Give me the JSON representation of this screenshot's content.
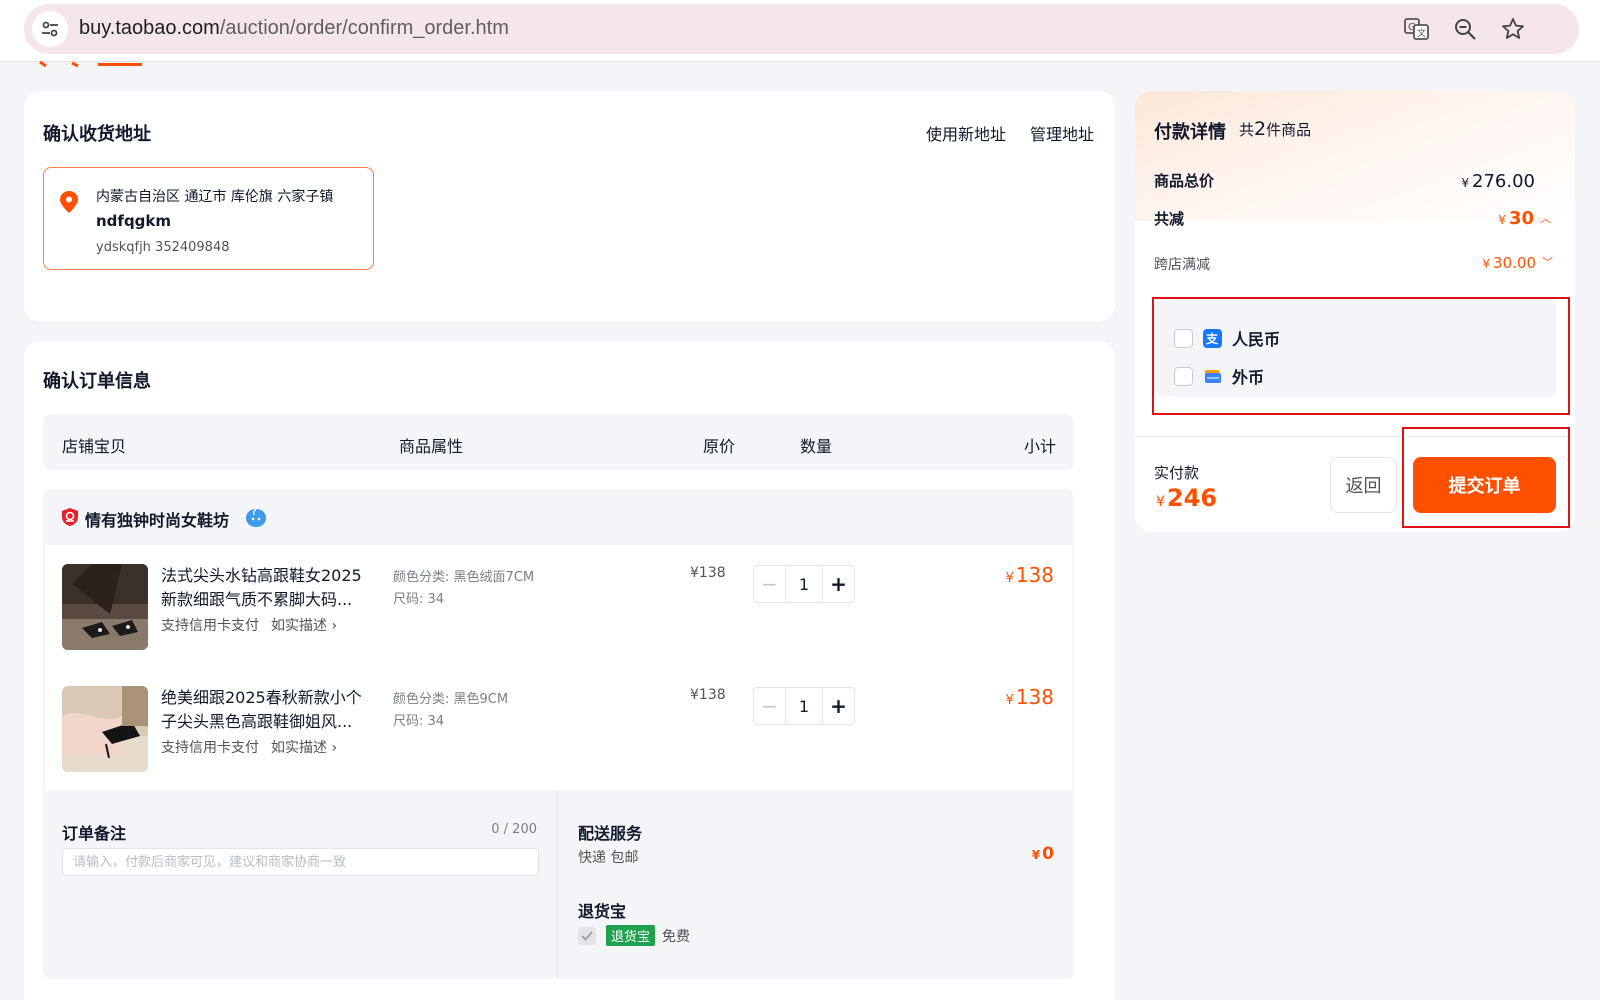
{
  "browser": {
    "url_host": "buy.taobao.com",
    "url_path": "/auction/order/confirm_order.htm",
    "icons": [
      "tune-icon",
      "translate-icon",
      "zoom-icon",
      "star-icon"
    ]
  },
  "address_section": {
    "title": "确认收货地址",
    "new_address_link": "使用新地址",
    "manage_address_link": "管理地址",
    "selected": {
      "region": "内蒙古自治区 通辽市 库伦旗 六家子镇",
      "name": "ndfqgkm",
      "detail": "ydskqfjh 352409848"
    }
  },
  "order_section": {
    "title": "确认订单信息",
    "columns": [
      "店铺宝贝",
      "商品属性",
      "原价",
      "数量",
      "小计"
    ],
    "shop_name": "情有独钟时尚女鞋坊",
    "items": [
      {
        "title": "法式尖头水钻高跟鞋女2025新款细跟气质不累脚大码...",
        "tag1": "支持信用卡支付",
        "tag2": "如实描述 ›",
        "attr_color": "颜色分类: 黑色绒面7CM",
        "attr_size": "尺码: 34",
        "price": "¥138",
        "qty": "1",
        "subtotal": "138"
      },
      {
        "title": "绝美细跟2025春秋新款小个子尖头黑色高跟鞋御姐风...",
        "tag1": "支持信用卡支付",
        "tag2": "如实描述 ›",
        "attr_color": "颜色分类: 黑色9CM",
        "attr_size": "尺码: 34",
        "price": "¥138",
        "qty": "1",
        "subtotal": "138"
      }
    ],
    "qty_minus": "−",
    "qty_plus": "+",
    "yen": "¥",
    "remark": {
      "title": "订单备注",
      "count": "0 / 200",
      "placeholder": "请输入，付款后商家可见，建议和商家协商一致"
    },
    "shipping": {
      "title": "配送服务",
      "method": "快递 包邮",
      "fee": "0"
    },
    "return_insurance": {
      "title": "退货宝",
      "badge": "退货宝",
      "price": "免费"
    }
  },
  "payment": {
    "title": "付款详情",
    "count_prefix": "共",
    "count": "2",
    "count_suffix": "件商品",
    "total_label": "商品总价",
    "total_value": "276.00",
    "discount_label": "共减",
    "discount_value": "30",
    "cross_store_label": "跨店满减",
    "cross_store_value": "30.00",
    "methods": [
      {
        "label": "人民币",
        "icon": "alipay-icon",
        "color": "#1677ff"
      },
      {
        "label": "外币",
        "icon": "card-icon",
        "color": "#3b82f6"
      }
    ],
    "actual_label": "实付款",
    "actual_value": "246",
    "back_button": "返回",
    "submit_button": "提交订单"
  },
  "colors": {
    "accent": "#ff5000",
    "highlight_box": "#e0101a",
    "badge_green": "#1fa14e"
  }
}
